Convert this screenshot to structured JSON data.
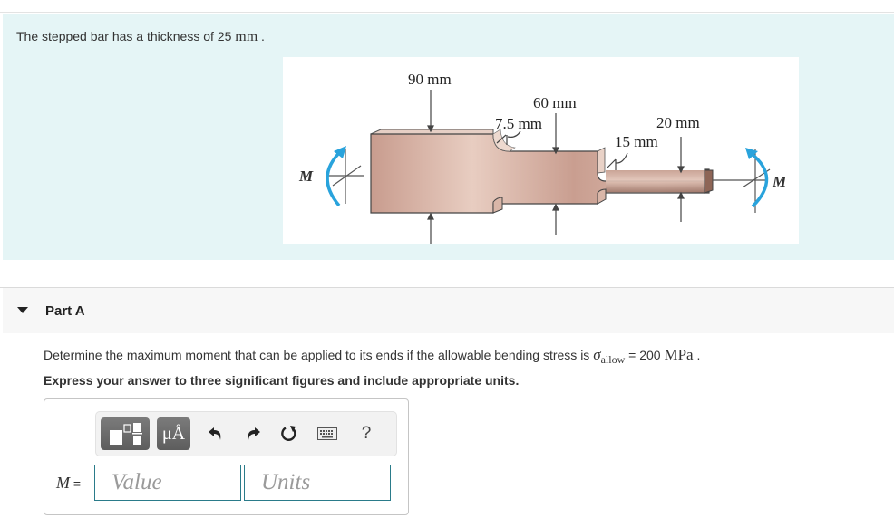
{
  "intro": {
    "text": "The stepped bar has a thickness of 25 ",
    "unit": "mm",
    "end": " ."
  },
  "figure": {
    "dimensions": {
      "d1": "90 mm",
      "d2": "60 mm",
      "r1": "7.5 mm",
      "d3": "20 mm",
      "r2": "15 mm"
    },
    "moment_left": "M",
    "moment_right": "M",
    "colors": {
      "bar": "#d9b3a6",
      "moment_arrow": "#29a3dc"
    }
  },
  "part": {
    "title": "Part A",
    "question_pre": "Determine the maximum moment that can be applied to its ends if the allowable bending stress is ",
    "sigma": "σ",
    "sigma_sub": "allow",
    "question_eq": " = 200 ",
    "question_unit": "MPa",
    "question_end": " .",
    "instruction": "Express your answer to three significant figures and include appropriate units."
  },
  "answer": {
    "variable": "M",
    "equals": " =",
    "value_placeholder": "Value",
    "units_placeholder": "Units",
    "toolbar": {
      "templates_icon": "templates-icon",
      "symbols_label": "μÅ",
      "undo_icon": "undo-icon",
      "redo_icon": "redo-icon",
      "reset_icon": "reset-icon",
      "keyboard_icon": "keyboard-icon",
      "help_label": "?"
    },
    "colors": {
      "field_border": "#2a7b8a"
    }
  }
}
